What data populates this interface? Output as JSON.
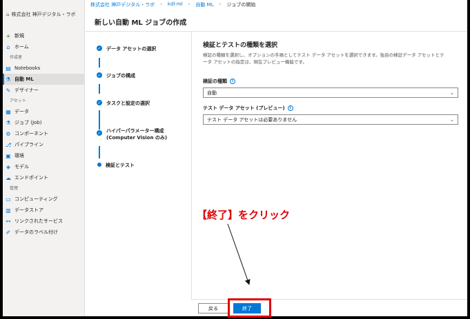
{
  "breadcrumb": {
    "items": [
      "株式会社 神戸デジタル・ラボ",
      "kdl-ml",
      "自動 ML",
      "ジョブの開始"
    ]
  },
  "sidebar": {
    "workspace": "株式会社 神戸デジタル・ラボ",
    "new": "新規",
    "home": "ホーム",
    "section_author": "作成者",
    "notebooks": "Notebooks",
    "automl": "自動 ML",
    "designer": "デザイナー",
    "section_assets": "アセット",
    "data": "データ",
    "jobs": "ジョブ (Job)",
    "components": "コンポーネント",
    "pipelines": "パイプライン",
    "environments": "環境",
    "models": "モデル",
    "endpoints": "エンドポイント",
    "section_manage": "管理",
    "compute": "コンピューティング",
    "datastores": "データストア",
    "linked_services": "リンクされたサービス",
    "data_labeling": "データのラベル付け"
  },
  "page": {
    "title": "新しい自動 ML ジョブの作成"
  },
  "steps": [
    {
      "label": "データ アセットの選択"
    },
    {
      "label": "ジョブの構成"
    },
    {
      "label": "タスクと設定の選択"
    },
    {
      "label": "ハイパーパラメーター構成",
      "sub": "(Computer Vision のみ)"
    },
    {
      "label": "検証とテスト"
    }
  ],
  "form": {
    "heading": "検証とテストの種類を選択",
    "desc1": "検証の種類を選択し、オプションの手順としてテスト データ アセットを選択できます。独自の検証データ アセットとテ",
    "desc2": "ータ アセットの指定は、現在プレビュー機能です。",
    "validation_label": "検証の種類",
    "validation_value": "自動",
    "test_label": "テスト データ アセット (プレビュー)",
    "test_value": "テスト データ アセットは必要ありません"
  },
  "footer": {
    "back_label": "戻る",
    "finish_label": "終了"
  },
  "annotation": "【終了】をクリック",
  "colors": {
    "accent": "#0078d4",
    "highlight": "#e00000"
  }
}
